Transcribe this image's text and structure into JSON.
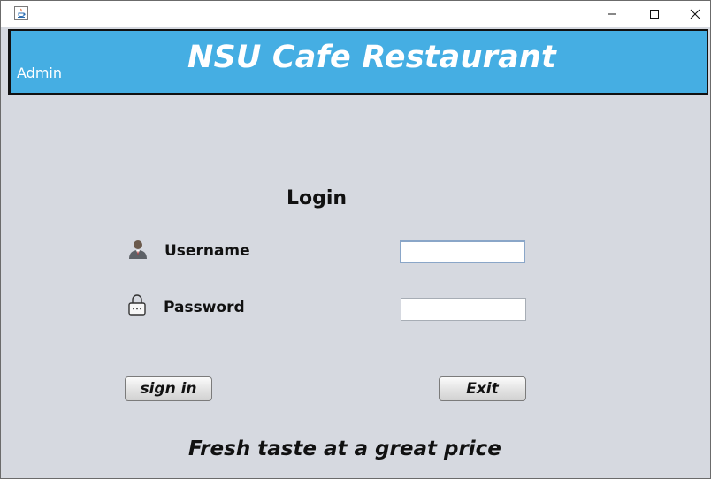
{
  "window": {
    "minimize_glyph": "—",
    "maximize_glyph": "☐",
    "close_glyph": "✕",
    "app_icon": "java-icon"
  },
  "banner": {
    "title": "NSU Cafe Restaurant",
    "role_label": "Admin",
    "color": "#45aee3"
  },
  "login": {
    "heading": "Login",
    "username_label": "Username",
    "password_label": "Password",
    "username_value": "",
    "password_value": "",
    "user_icon": "user-icon",
    "lock_icon": "lock-icon"
  },
  "buttons": {
    "sign_in": "sign in",
    "exit": "Exit"
  },
  "footer": {
    "tagline": "Fresh taste at a great price"
  }
}
